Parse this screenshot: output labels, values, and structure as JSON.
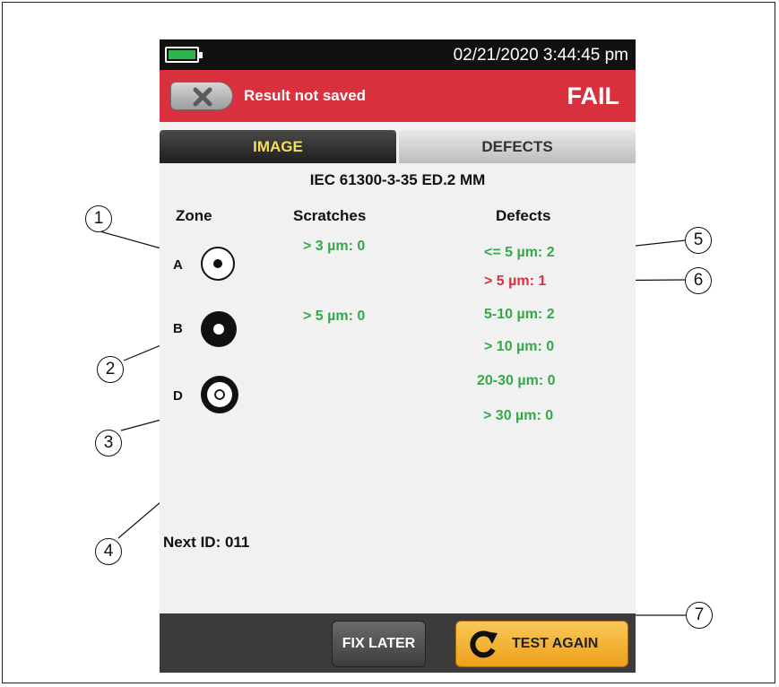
{
  "status": {
    "datetime": "02/21/2020 3:44:45 pm"
  },
  "result": {
    "message": "Result not saved",
    "status": "FAIL",
    "status_color": "#d8303d"
  },
  "tabs": [
    {
      "label": "IMAGE",
      "active": true
    },
    {
      "label": "DEFECTS",
      "active": false
    }
  ],
  "standard": "IEC 61300-3-35 ED.2 MM",
  "columns": {
    "zone": "Zone",
    "scratches": "Scratches",
    "defects": "Defects"
  },
  "zones": [
    {
      "letter": "A",
      "icon": "zone-a-icon"
    },
    {
      "letter": "B",
      "icon": "zone-b-icon"
    },
    {
      "letter": "D",
      "icon": "zone-d-icon"
    }
  ],
  "scratches": [
    "> 3 µm: 0",
    "> 5 µm: 0"
  ],
  "defects": [
    {
      "text": "<= 5 µm: 2",
      "state": "pass"
    },
    {
      "text": "> 5 µm: 1",
      "state": "fail"
    },
    {
      "text": "5-10 µm: 2",
      "state": "pass"
    },
    {
      "text": "> 10 µm: 0",
      "state": "pass"
    },
    {
      "text": "20-30 µm: 0",
      "state": "pass"
    },
    {
      "text": "> 30 µm: 0",
      "state": "pass"
    }
  ],
  "next_id": "Next ID: 011",
  "buttons": {
    "fix_later": "FIX LATER",
    "test_again": "TEST AGAIN"
  },
  "callouts": [
    "1",
    "2",
    "3",
    "4",
    "5",
    "6",
    "7"
  ],
  "colors": {
    "pass": "#35a84a",
    "fail": "#d8303d",
    "accent": "#f4de5b",
    "battery": "#2fb34b"
  }
}
